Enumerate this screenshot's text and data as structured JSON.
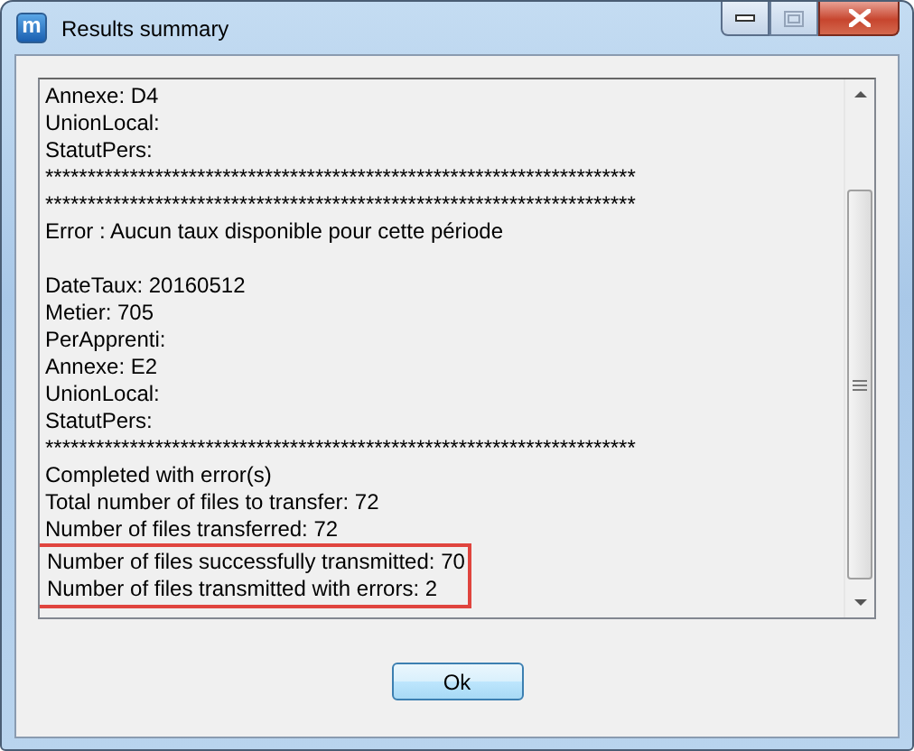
{
  "window": {
    "title": "Results summary",
    "icon_letter": "m",
    "maximize_disabled": true
  },
  "log": {
    "lines": [
      {
        "kind": "text",
        "text": "Annexe: D4",
        "highlighted": false
      },
      {
        "kind": "text",
        "text": "UnionLocal:",
        "highlighted": false
      },
      {
        "kind": "text",
        "text": "StatutPers:",
        "highlighted": false
      },
      {
        "kind": "text",
        "text": "**********************************************************************",
        "highlighted": false
      },
      {
        "kind": "text",
        "text": "**********************************************************************",
        "highlighted": false
      },
      {
        "kind": "text",
        "text": "Error : Aucun taux disponible pour cette période",
        "highlighted": false
      },
      {
        "kind": "blank",
        "highlighted": false
      },
      {
        "kind": "text",
        "text": "DateTaux: 20160512",
        "highlighted": false
      },
      {
        "kind": "text",
        "text": "Metier: 705",
        "highlighted": false
      },
      {
        "kind": "text",
        "text": "PerApprenti:",
        "highlighted": false
      },
      {
        "kind": "text",
        "text": "Annexe: E2",
        "highlighted": false
      },
      {
        "kind": "text",
        "text": "UnionLocal:",
        "highlighted": false
      },
      {
        "kind": "text",
        "text": "StatutPers:",
        "highlighted": false
      },
      {
        "kind": "text",
        "text": "**********************************************************************",
        "highlighted": false
      },
      {
        "kind": "text",
        "text": "Completed with error(s)",
        "highlighted": false
      },
      {
        "kind": "text",
        "text": "Total number of files to transfer: 72",
        "highlighted": false
      },
      {
        "kind": "text",
        "text": "Number of files transferred: 72",
        "highlighted": false
      },
      {
        "kind": "text",
        "text": "Number of files successfully transmitted: 70",
        "highlighted": true
      },
      {
        "kind": "text",
        "text": "Number of files transmitted with errors: 2",
        "highlighted": true
      }
    ]
  },
  "buttons": [
    {
      "label": "Ok"
    }
  ]
}
